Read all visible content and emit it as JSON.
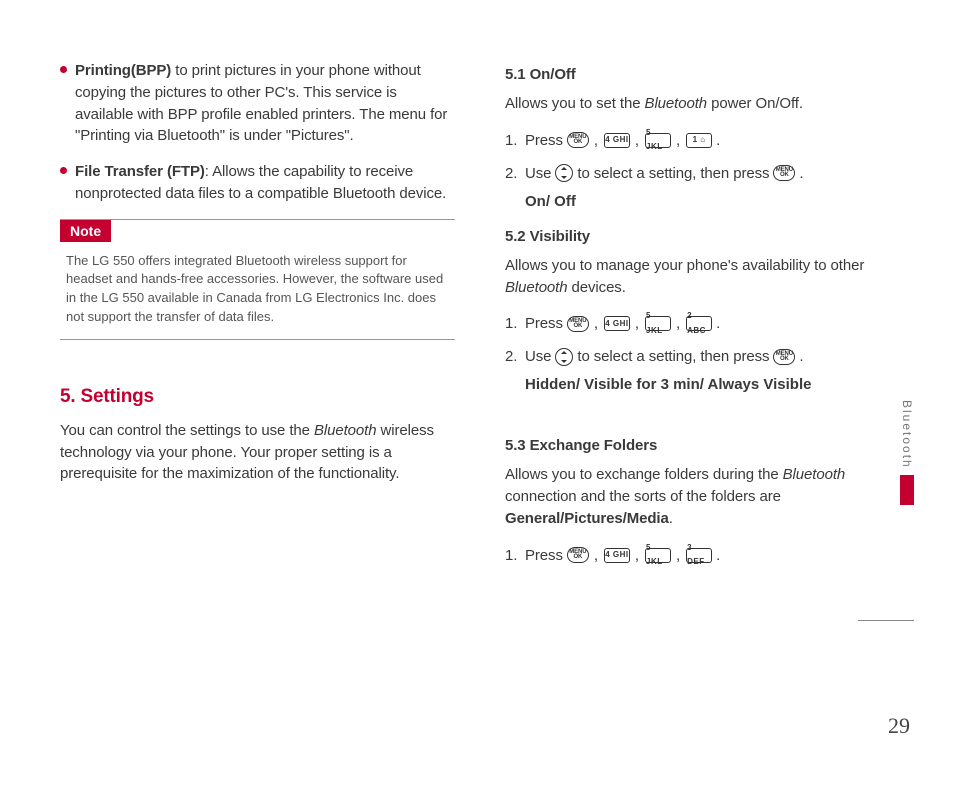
{
  "left": {
    "bullets": [
      {
        "bold": "Printing(BPP)",
        "rest": " to print pictures in your phone without copying the pictures to other PC's. This service is available with BPP profile enabled printers. The menu for \"Printing via Bluetooth\" is under \"Pictures\"."
      },
      {
        "bold": "File Transfer (FTP)",
        "rest": ": Allows the capability to receive nonprotected data files to a compatible Bluetooth device."
      }
    ],
    "note_label": "Note",
    "note_body": "The LG 550 offers integrated Bluetooth wireless support for headset and hands-free accessories.  However, the software used in the LG 550 available in Canada from LG Electronics Inc. does not support the transfer of data files.",
    "section_title": "5. Settings",
    "section_para_pre": "You can control the settings to use the ",
    "section_para_italic": "Bluetooth",
    "section_para_post": " wireless technology via your phone. Your proper setting is a prerequisite for the maximization of the functionality."
  },
  "right": {
    "s51": {
      "title": "5.1 On/Off",
      "desc_pre": "Allows you to set the ",
      "desc_italic": "Bluetooth",
      "desc_post": " power On/Off.",
      "step1_pre": "Press",
      "key_4": "4 GHI",
      "key_5": "5 JKL",
      "key_1": "1 ⌂",
      "step2_pre": "Use",
      "step2_mid": "to select a setting, then press",
      "options": "On/ Off"
    },
    "s52": {
      "title": "5.2 Visibility",
      "desc_pre": "Allows you to manage your phone's availability to other ",
      "desc_italic": "Bluetooth",
      "desc_post": " devices.",
      "step1_pre": "Press",
      "key_4": "4 GHI",
      "key_5": "5 JKL",
      "key_2": "2 ABC",
      "step2_pre": "Use",
      "step2_mid": "to select a setting, then press",
      "options": "Hidden/ Visible for 3 min/ Always Visible"
    },
    "s53": {
      "title": "5.3 Exchange Folders",
      "desc_pre": "Allows you to exchange folders during the ",
      "desc_italic": "Bluetooth",
      "desc_post": " connection and the sorts of the folders are ",
      "desc_bold": "General/Pictures/Media",
      "step1_pre": "Press",
      "key_4": "4 GHI",
      "key_5": "5 JKL",
      "key_3": "3 DEF"
    }
  },
  "side_label": "Bluetooth",
  "page_number": "29",
  "ok_top": "MENU",
  "ok_bot": "OK",
  "period": ".",
  "comma": ","
}
